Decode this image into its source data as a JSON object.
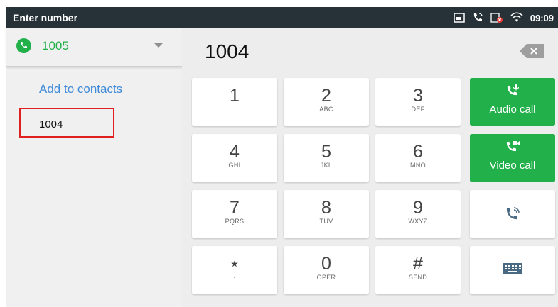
{
  "status_bar": {
    "title": "Enter number",
    "time": "09:09",
    "icons": [
      "picture-in-picture-icon",
      "phone-ringing-icon",
      "sim-error-icon",
      "wifi-icon"
    ]
  },
  "account": {
    "number": "1005",
    "icon": "phone-icon"
  },
  "left_panel": {
    "add_to_contacts": "Add to contacts",
    "result_number": "1004"
  },
  "dialer": {
    "entered_number": "1004",
    "backspace_icon": "backspace-icon"
  },
  "keypad": [
    {
      "main": "1",
      "sub": ""
    },
    {
      "main": "2",
      "sub": "ABC"
    },
    {
      "main": "3",
      "sub": "DEF"
    },
    {
      "main": "4",
      "sub": "GHI"
    },
    {
      "main": "5",
      "sub": "JKL"
    },
    {
      "main": "6",
      "sub": "MNO"
    },
    {
      "main": "7",
      "sub": "PQRS"
    },
    {
      "main": "8",
      "sub": "TUV"
    },
    {
      "main": "9",
      "sub": "WXYZ"
    },
    {
      "main": "⋆",
      "sub": "·"
    },
    {
      "main": "0",
      "sub": "OPER"
    },
    {
      "main": "#",
      "sub": "SEND"
    }
  ],
  "actions": {
    "audio_call": "Audio call",
    "video_call": "Video call",
    "transfer_icon": "call-transfer-icon",
    "keyboard_icon": "keyboard-icon"
  },
  "colors": {
    "status_bar": "#263238",
    "accent_green": "#22b04b",
    "link_blue": "#3f8bd9",
    "highlight_red": "#e02020"
  }
}
